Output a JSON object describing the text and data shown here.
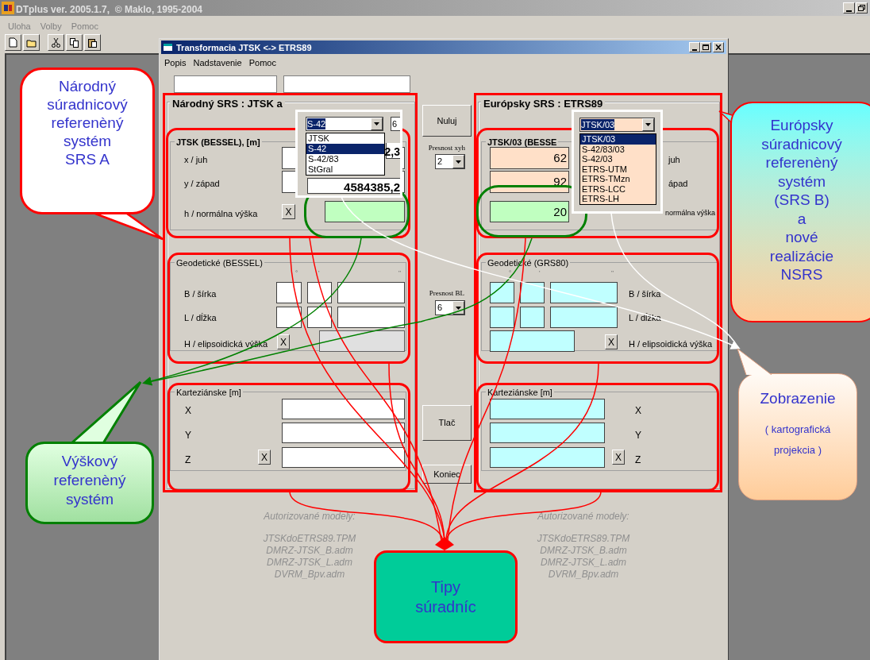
{
  "app": {
    "title": "DTplus ver. 2005.1.7,  © Maklo, 1995-2004",
    "menu": [
      {
        "label": "Uloha",
        "disabled": true
      },
      {
        "label": "Volby",
        "disabled": true
      },
      {
        "label": "Pomoc",
        "disabled": true
      }
    ]
  },
  "dialog": {
    "title": "Transformacia JTSK <-> ETRS89",
    "menu": [
      "Popis",
      "Nadstavenie",
      "Pomoc"
    ],
    "national": {
      "title": "Národný SRS : JTSK a",
      "planar": {
        "title": "JTSK (BESSEL), [m]",
        "x_label": "x / juh",
        "x_value": "2,3",
        "y_label": "y / západ",
        "y_value": "4584385,2",
        "h_label": "h / normálna výška",
        "clear_button": "X"
      },
      "geodetic": {
        "title": "Geodetické (BESSEL)",
        "units": [
          "°",
          "'",
          "''"
        ],
        "b_label": "B / šírka",
        "l_label": "L / dĺžka",
        "h_label": "H / elipsoidická výška",
        "clear_button": "X"
      },
      "cartesian": {
        "title": "Karteziánske [m]",
        "labels": [
          "X",
          "Y",
          "Z"
        ],
        "clear_button": "X"
      },
      "models_title": "Autorizované modely:",
      "models": [
        "JTSKdoETRS89.TPM",
        "DMRZ-JTSK_B.adm",
        "DMRZ-JTSK_L.adm",
        "DVRM_Bpv.adm"
      ],
      "system_dropdown": {
        "value": "S-42",
        "items": [
          {
            "label": "JTSK",
            "selected": false
          },
          {
            "label": "S-42",
            "selected": true
          },
          {
            "label": "S-42/83",
            "selected": false
          },
          {
            "label": "StGral",
            "selected": false
          }
        ]
      },
      "precision_value": "6"
    },
    "middle": {
      "reset_button": "Nuluj",
      "precision_xyh": {
        "label": "Presnost xyh",
        "value": "2"
      },
      "precision_bl": {
        "label": "Presnost BL",
        "value": "6"
      },
      "print_button": "Tlač",
      "close_button": "Koniec"
    },
    "european": {
      "title": "Európsky SRS : ETRS89",
      "planar": {
        "title": "JTSK/03 (BESSE",
        "x_label": "juh",
        "x_value": "62",
        "y_label": "ápad",
        "y_value": "92",
        "h_label": "normálna výška",
        "h_value": "20"
      },
      "geodetic": {
        "title": "Geodetické (GRS80)",
        "units": [
          "°",
          "'",
          "''"
        ],
        "b_label": "B / šírka",
        "l_label": "L / dĺžka",
        "h_label": "H / elipsoidická výška",
        "clear_button": "X"
      },
      "cartesian": {
        "title": "Karteziánske [m]",
        "labels": [
          "X",
          "Y",
          "Z"
        ],
        "clear_button": "X"
      },
      "models_title": "Autorizované modely:",
      "models": [
        "JTSKdoETRS89.TPM",
        "DMRZ-JTSK_B.adm",
        "DMRZ-JTSK_L.adm",
        "DVRM_Bpv.adm"
      ],
      "system_dropdown": {
        "value": "JTSK/03",
        "items": [
          {
            "label": "JTSK/03",
            "selected": true
          },
          {
            "label": "S-42/83/03",
            "selected": false
          },
          {
            "label": "S-42/03",
            "selected": false
          },
          {
            "label": "ETRS-UTM",
            "selected": false
          },
          {
            "label": "ETRS-TMzn",
            "selected": false
          },
          {
            "label": "ETRS-LCC",
            "selected": false
          },
          {
            "label": "ETRS-LH",
            "selected": false
          }
        ]
      }
    }
  },
  "callouts": [
    {
      "text": "Národný\nsúradnicový\nreferenèný\nsystém\nSRS A"
    },
    {
      "text": "Európsky\nsúradnicový\nreferenèný\nsystém\n(SRS B)\na\nnové\nrealizácie\nNSRS"
    },
    {
      "text": "Výškový\nreferenèný\nsystém"
    },
    {
      "text": "Zobrazenie",
      "note": "( kartografická\nprojekcia )"
    },
    {
      "text": "Tipy\nsúradníc"
    }
  ]
}
